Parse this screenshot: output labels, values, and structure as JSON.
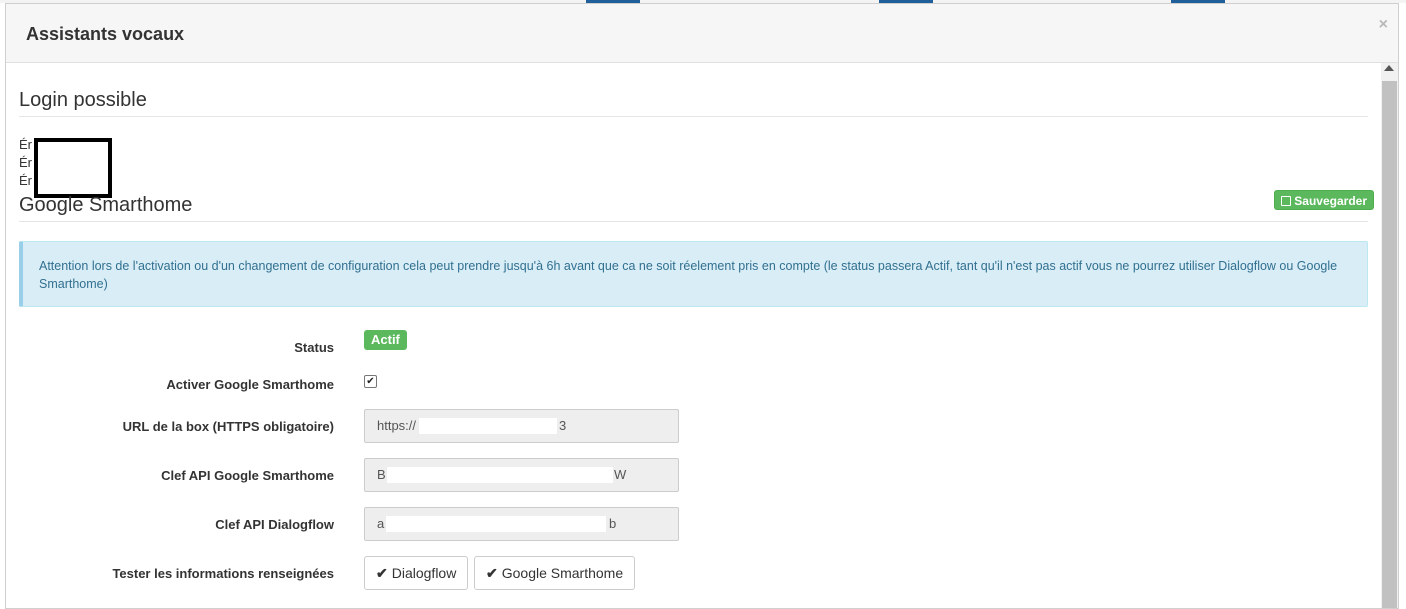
{
  "modal": {
    "title": "Assistants vocaux",
    "close_icon": "×"
  },
  "login_section": {
    "title": "Login possible",
    "lines": [
      "Ér",
      "Ér",
      "Ér"
    ]
  },
  "google_section": {
    "title": "Google Smarthome",
    "save_label": "Sauvegarder",
    "alert_text": "Attention lors de l'activation ou d'un changement de configuration cela peut prendre jusqu'à 6h avant que ca ne soit réelement pris en compte (le status passera Actif, tant qu'il n'est pas actif vous ne pourrez utiliser Dialogflow ou Google Smarthome)"
  },
  "form": {
    "status": {
      "label": "Status",
      "value": "Actif"
    },
    "enable": {
      "label": "Activer Google Smarthome",
      "checked": true,
      "check_glyph": "✔"
    },
    "url": {
      "label": "URL de la box (HTTPS obligatoire)",
      "value_start": "https://",
      "value_end": "3"
    },
    "google_api_key": {
      "label": "Clef API Google Smarthome",
      "value_start": "B",
      "value_end": "W"
    },
    "dialogflow_api_key": {
      "label": "Clef API Dialogflow",
      "value_start": "a",
      "value_end": "b"
    },
    "test": {
      "label": "Tester les informations renseignées",
      "buttons": [
        {
          "icon": "check-icon",
          "glyph": "✔",
          "label": "Dialogflow"
        },
        {
          "icon": "check-icon",
          "glyph": "✔",
          "label": "Google Smarthome"
        }
      ]
    }
  },
  "colors": {
    "success": "#5cb85c",
    "info_bg": "#d9edf7",
    "info_text": "#31708f",
    "header_bg": "#f6f6f6"
  }
}
